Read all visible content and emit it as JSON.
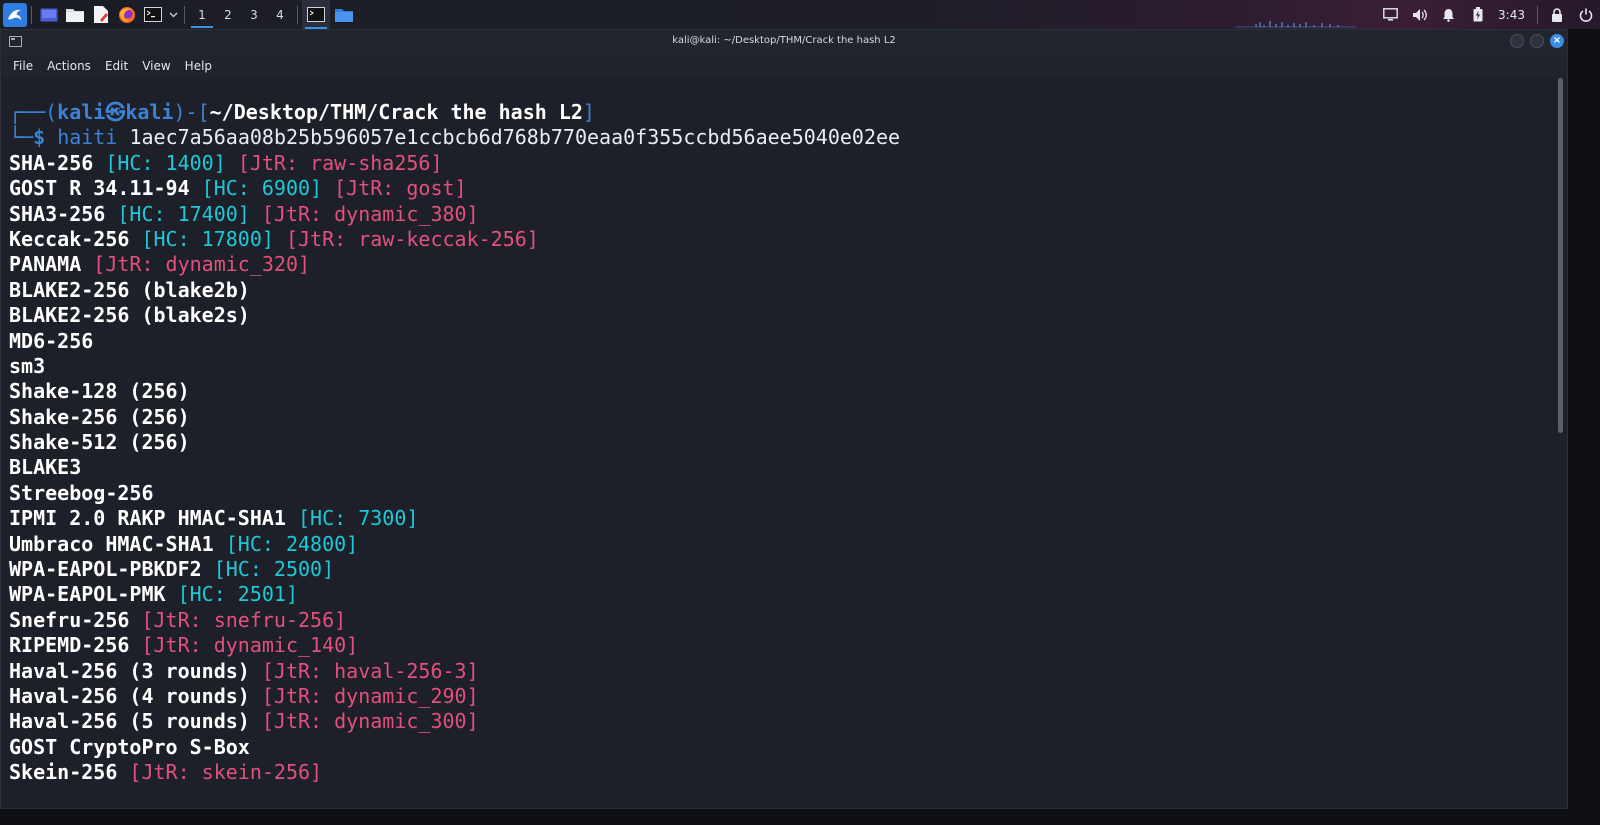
{
  "panel": {
    "workspaces": [
      "1",
      "2",
      "3",
      "4"
    ],
    "active_workspace": 0,
    "clock": "3:43",
    "accent": "#3d8ee8"
  },
  "window": {
    "title": "kali@kali: ~/Desktop/THM/Crack the hash L2",
    "menu": [
      "File",
      "Actions",
      "Edit",
      "View",
      "Help"
    ]
  },
  "terminal": {
    "prompt": {
      "frame_open": "┌──(",
      "user": "kali㉿kali",
      "frame_mid": ")-[",
      "path": "~/Desktop/THM/Crack the hash L2",
      "frame_close": "]",
      "frame_bottom": "└─",
      "dollar": "$",
      "command": "haiti",
      "argument": "1aec7a56aa08b25b596057e1ccbcb6d768b770eaa0f355ccbd56aee5040e02ee"
    },
    "results": [
      {
        "name": "SHA-256",
        "hc": "[HC: 1400]",
        "jtr": "[JtR: raw-sha256]"
      },
      {
        "name": "GOST R 34.11-94",
        "hc": "[HC: 6900]",
        "jtr": "[JtR: gost]"
      },
      {
        "name": "SHA3-256",
        "hc": "[HC: 17400]",
        "jtr": "[JtR: dynamic_380]"
      },
      {
        "name": "Keccak-256",
        "hc": "[HC: 17800]",
        "jtr": "[JtR: raw-keccak-256]"
      },
      {
        "name": "PANAMA",
        "hc": "",
        "jtr": "[JtR: dynamic_320]"
      },
      {
        "name": "BLAKE2-256 (blake2b)",
        "hc": "",
        "jtr": ""
      },
      {
        "name": "BLAKE2-256 (blake2s)",
        "hc": "",
        "jtr": ""
      },
      {
        "name": "MD6-256",
        "hc": "",
        "jtr": ""
      },
      {
        "name": "sm3",
        "hc": "",
        "jtr": ""
      },
      {
        "name": "Shake-128 (256)",
        "hc": "",
        "jtr": ""
      },
      {
        "name": "Shake-256 (256)",
        "hc": "",
        "jtr": ""
      },
      {
        "name": "Shake-512 (256)",
        "hc": "",
        "jtr": ""
      },
      {
        "name": "BLAKE3",
        "hc": "",
        "jtr": ""
      },
      {
        "name": "Streebog-256",
        "hc": "",
        "jtr": ""
      },
      {
        "name": "IPMI 2.0 RAKP HMAC-SHA1",
        "hc": "[HC: 7300]",
        "jtr": ""
      },
      {
        "name": "Umbraco HMAC-SHA1",
        "hc": "[HC: 24800]",
        "jtr": ""
      },
      {
        "name": "WPA-EAPOL-PBKDF2",
        "hc": "[HC: 2500]",
        "jtr": ""
      },
      {
        "name": "WPA-EAPOL-PMK",
        "hc": "[HC: 2501]",
        "jtr": ""
      },
      {
        "name": "Snefru-256",
        "hc": "",
        "jtr": "[JtR: snefru-256]"
      },
      {
        "name": "RIPEMD-256",
        "hc": "",
        "jtr": "[JtR: dynamic_140]"
      },
      {
        "name": "Haval-256 (3 rounds)",
        "hc": "",
        "jtr": "[JtR: haval-256-3]"
      },
      {
        "name": "Haval-256 (4 rounds)",
        "hc": "",
        "jtr": "[JtR: dynamic_290]"
      },
      {
        "name": "Haval-256 (5 rounds)",
        "hc": "",
        "jtr": "[JtR: dynamic_300]"
      },
      {
        "name": "GOST CryptoPro S-Box",
        "hc": "",
        "jtr": ""
      },
      {
        "name": "Skein-256",
        "hc": "",
        "jtr": "[JtR: skein-256]"
      }
    ],
    "colors": {
      "hashcat": "#1ec8d8",
      "john": "#e2507d",
      "prompt": "#3b82d7"
    }
  }
}
